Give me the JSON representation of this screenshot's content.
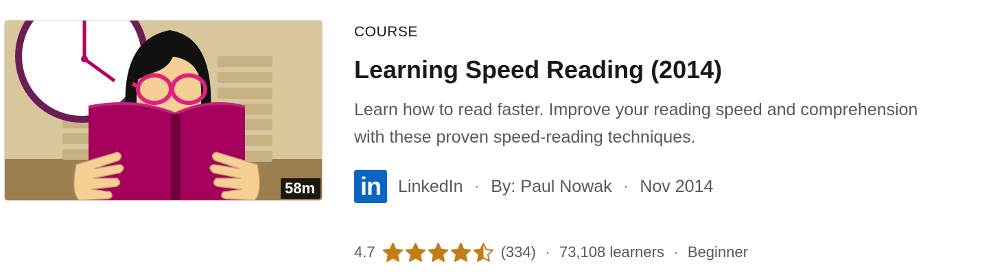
{
  "course": {
    "type_label": "COURSE",
    "title": "Learning Speed Reading (2014)",
    "description": "Learn how to read faster. Improve your reading speed and comprehension with these proven speed-reading techniques.",
    "duration": "58m",
    "thumbnail_icon": "reading-woman-illustration",
    "provider": {
      "logo_text": "in",
      "logo_color": "#0a66c2",
      "name": "LinkedIn"
    },
    "separator": "·",
    "author": "By: Paul Nowak",
    "date": "Nov 2014",
    "rating": {
      "value": "4.7",
      "stars_filled": 4.5,
      "stars_total": 5,
      "star_color": "#c37d16",
      "count": "(334)"
    },
    "learners": "73,108 learners",
    "level": "Beginner"
  },
  "colors": {
    "title": "#191919",
    "secondary_text": "#595959",
    "thumbnail_background": "#d8c79c",
    "book": "#a5005c",
    "glasses": "#e0237a"
  }
}
